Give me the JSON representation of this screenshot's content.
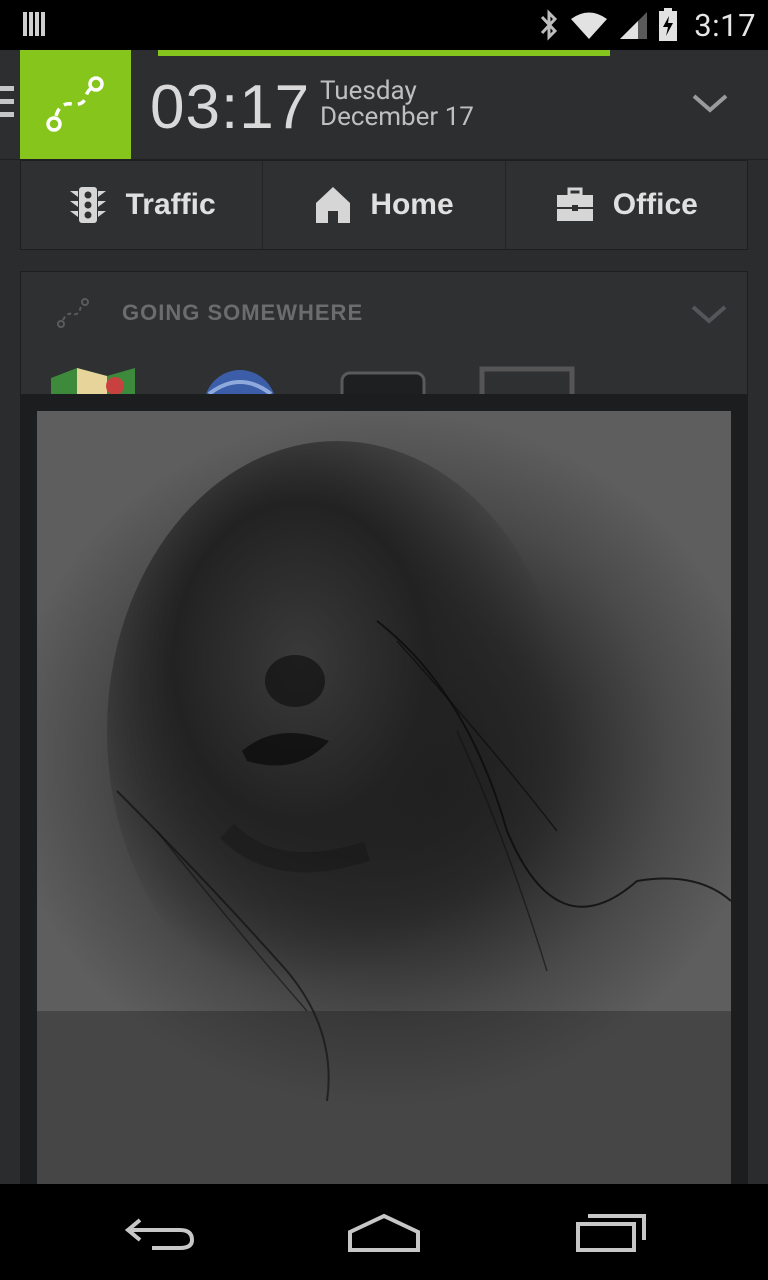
{
  "status_bar": {
    "time": "3:17",
    "icons": [
      "notification-bars-icon",
      "bluetooth-icon",
      "wifi-icon",
      "cell-signal-icon",
      "battery-charging-icon"
    ]
  },
  "header": {
    "clock": "03:17",
    "day": "Tuesday",
    "date": "December 17",
    "accent_color": "#86c51b",
    "progress_color": "#85c41c"
  },
  "shortcuts": [
    {
      "label": "Traffic",
      "icon": "traffic-light-icon"
    },
    {
      "label": "Home",
      "icon": "home-icon"
    },
    {
      "label": "Office",
      "icon": "briefcase-icon"
    }
  ],
  "going_card": {
    "title": "GOING SOMEWHERE",
    "apps": [
      "maps-app-icon",
      "globe-app-icon",
      "tablet-app-icon",
      "frame-app-icon"
    ]
  },
  "nav_bar": {
    "buttons": [
      "back-icon",
      "home-nav-icon",
      "recents-icon"
    ]
  }
}
